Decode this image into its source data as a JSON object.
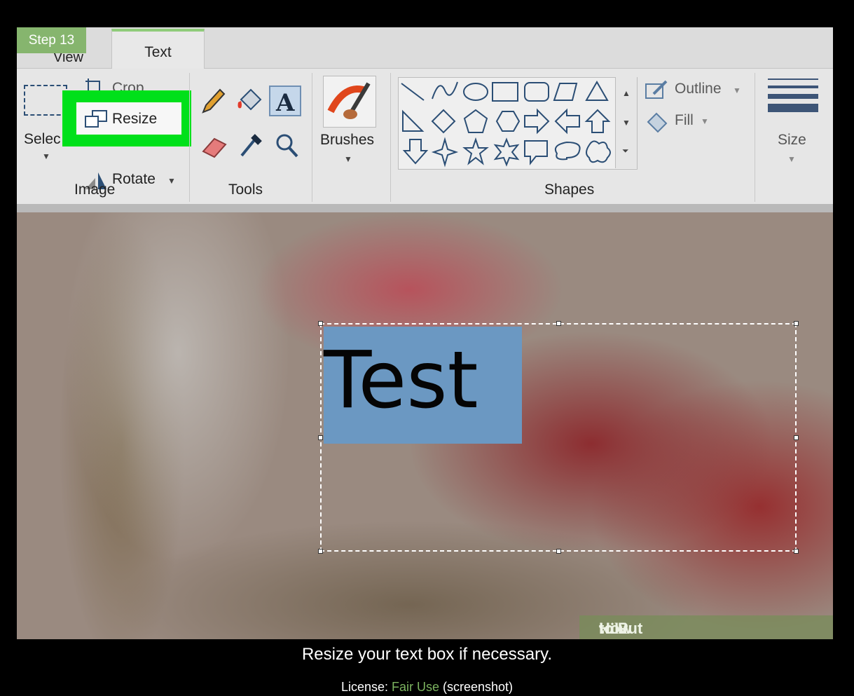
{
  "step_badge": "Step 13",
  "ribbon": {
    "tabs": {
      "view": "View",
      "text": "Text"
    },
    "image_group": {
      "select": "Selec",
      "crop": "Crop",
      "resize": "Resize",
      "rotate": "Rotate",
      "label": "Image"
    },
    "tools_group": {
      "label": "Tools"
    },
    "brushes": "Brushes",
    "shapes_group": {
      "outline": "Outline",
      "fill": "Fill",
      "label": "Shapes"
    },
    "size": "Size",
    "highlight_color": "#00e01a"
  },
  "canvas": {
    "text_content": "Test",
    "text_highlight_color": "#6b98c2"
  },
  "watermark": {
    "wiki": "wiki",
    "how": "How",
    "rest": " to Put Text on Pictures"
  },
  "caption": "Resize your text box if necessary.",
  "license": {
    "label": "License: ",
    "link": "Fair Use",
    "suffix": " (screenshot)"
  }
}
